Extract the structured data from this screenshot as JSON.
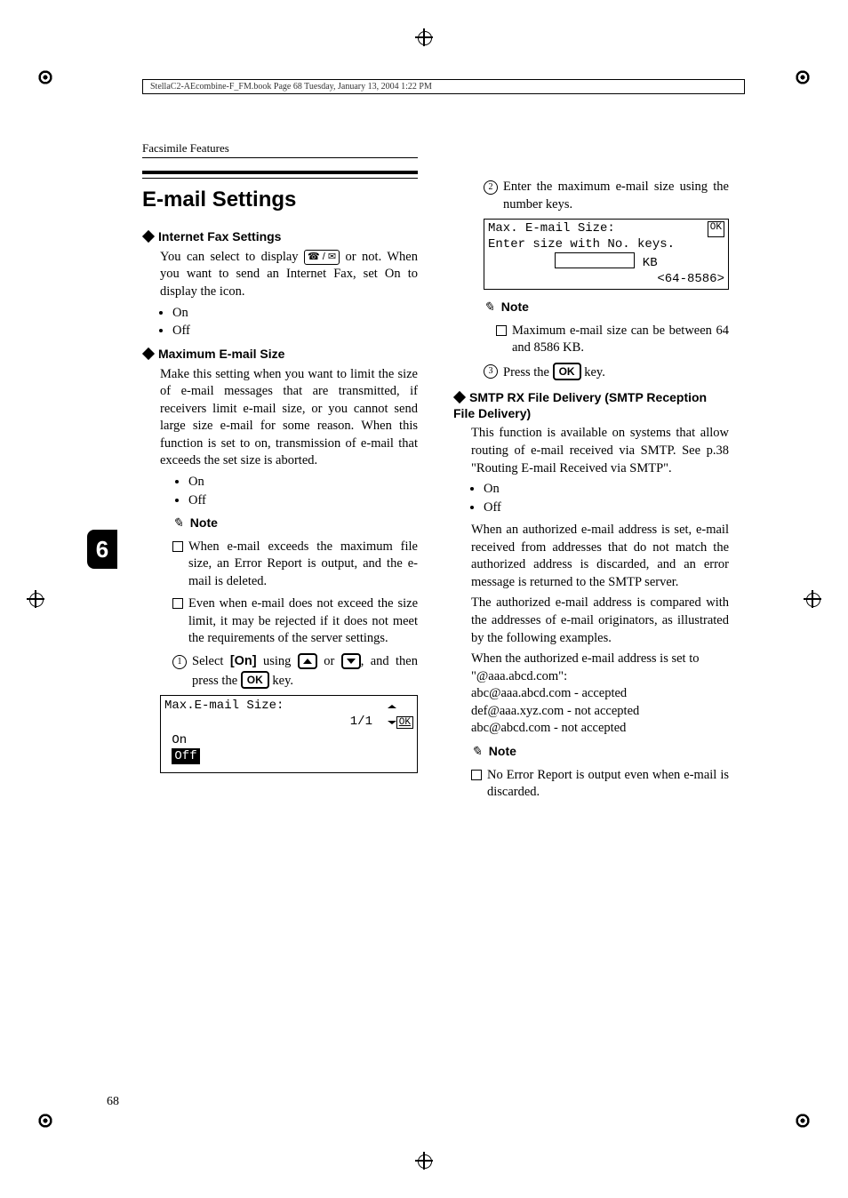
{
  "header_line": "StellaC2-AEcombine-F_FM.book  Page 68  Tuesday, January 13, 2004  1:22 PM",
  "section_label": "Facsimile Features",
  "title": "E-mail Settings",
  "side_tab": "6",
  "page_number": "68",
  "ifs": {
    "heading": "Internet Fax Settings",
    "body": "You can select to display ",
    "body2": " or not. When you want to send an Internet Fax, set On to display the icon.",
    "on": "On",
    "off": "Off",
    "icon_content": "☎ / ✉"
  },
  "mes": {
    "heading": "Maximum E-mail Size",
    "body": "Make this setting when you want to limit the size of e-mail messages that are transmitted, if receivers limit e-mail size, or you cannot send large size e-mail for some reason. When this function is set to on, transmission of e-mail that exceeds the set size is aborted.",
    "on": "On",
    "off": "Off",
    "note_label": "Note",
    "note1": "When e-mail exceeds the maximum file size, an Error Report is output, and the e-mail is deleted.",
    "note2": "Even when e-mail does not exceed the size limit, it may be rejected if it does not meet the requirements of the server settings.",
    "step1a": "Select ",
    "step1_on": "[On]",
    "step1b": " using ",
    "step1c": " or ",
    "step1d": ", and then press the ",
    "step1_ok": "OK",
    "step1e": " key.",
    "lcd1_title": "Max.E-mail Size:",
    "lcd1_page": "1/1",
    "lcd1_ok": "OK",
    "lcd1_on": "On",
    "lcd1_off": "Off",
    "step2": "Enter the maximum e-mail size using the number keys.",
    "lcd2_title": "Max. E-mail Size:",
    "lcd2_ok": "OK",
    "lcd2_prompt": "Enter size with No. keys.",
    "lcd2_unit": "KB",
    "lcd2_range": "<64-8586>",
    "note3_label": "Note",
    "note3": "Maximum e-mail size can be between 64 and 8586 KB.",
    "step3a": "Press the ",
    "step3_ok": "OK",
    "step3b": " key."
  },
  "smtp": {
    "heading": "SMTP RX File Delivery (SMTP Reception File Delivery)",
    "body1": "This function is available on systems that allow routing of e-mail received via SMTP. See p.38 \"Routing E-mail Received via SMTP\".",
    "on": "On",
    "off": "Off",
    "body2": "When an authorized e-mail address is set, e-mail received from addresses that do not match the authorized address is discarded, and an error message is returned to the SMTP server.",
    "body3": "The authorized e-mail address is compared with the addresses of e-mail originators, as illustrated by the following examples.",
    "body4": "When the authorized e-mail address is set to \"@aaa.abcd.com\":",
    "ex1": "abc@aaa.abcd.com - accepted",
    "ex2": "def@aaa.xyz.com - not accepted",
    "ex3": "abc@abcd.com - not accepted",
    "note_label": "Note",
    "note1": "No Error Report is output even when e-mail is discarded."
  }
}
